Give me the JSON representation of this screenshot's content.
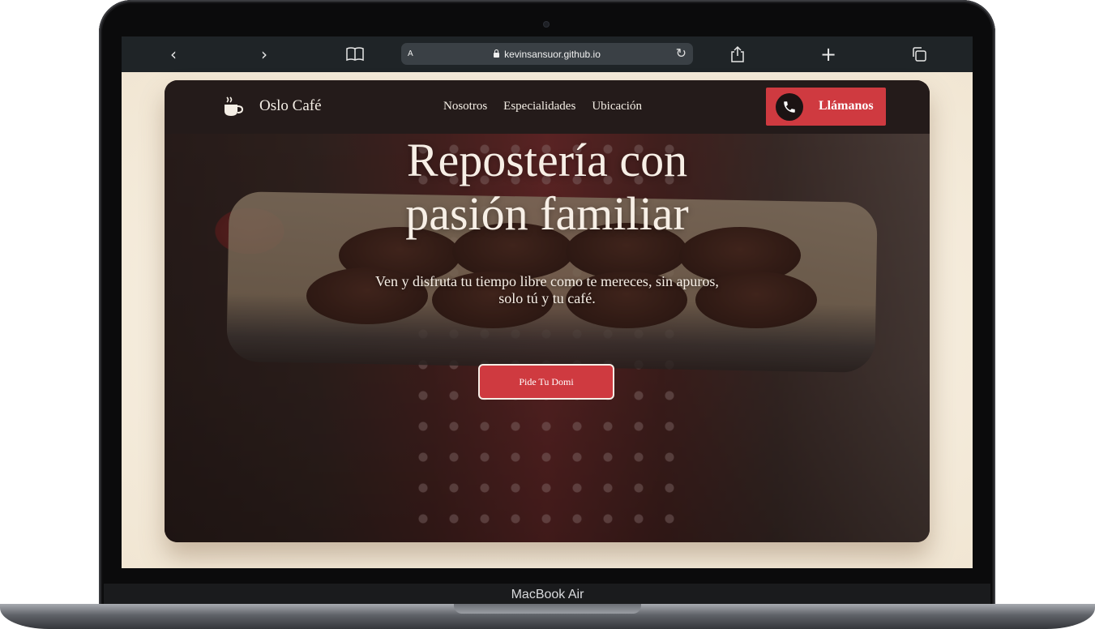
{
  "device": {
    "label": "MacBook Air"
  },
  "browser": {
    "back_icon": "‹",
    "forward_icon": "›",
    "bookmarks_icon": "📖",
    "url_prefix": "A",
    "url": "kevinsansuor.github.io",
    "reload_icon": "↻",
    "share_icon": "⇪",
    "new_tab_icon": "+",
    "tabs_icon": "⧉"
  },
  "site": {
    "brand": "Oslo Café",
    "nav": [
      "Nosotros",
      "Especialidades",
      "Ubicación"
    ],
    "call_button": "Llámanos",
    "hero_title_line1": "Repostería con",
    "hero_title_line2": "pasión familiar",
    "hero_subtitle": "Ven y disfruta tu tiempo libre como te mereces, sin apuros, solo tú y tu café.",
    "cta": "Pide Tu Domi"
  },
  "colors": {
    "accent": "#cf3a40",
    "card_bg": "#241b1a",
    "page_bg": "#f3ebde"
  }
}
